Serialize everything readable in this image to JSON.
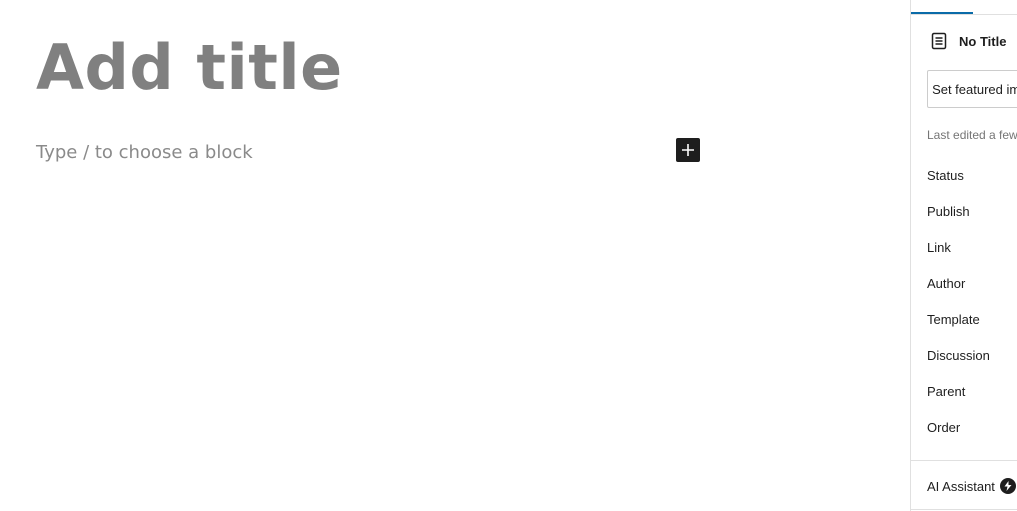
{
  "editor": {
    "title_placeholder": "Add title",
    "block_placeholder": "Type / to choose a block",
    "inserter_icon": "plus-icon"
  },
  "sidebar": {
    "document_icon": "page-icon",
    "document_title": "No Title",
    "featured_image_button": "Set featured image",
    "last_edited": "Last edited a few seconds ago",
    "meta_items": [
      "Status",
      "Publish",
      "Link",
      "Author",
      "Template",
      "Discussion",
      "Parent",
      "Order"
    ],
    "ai_assistant": {
      "label": "AI Assistant",
      "icon": "bolt-icon"
    },
    "accent_color": "#0a6ba8"
  }
}
